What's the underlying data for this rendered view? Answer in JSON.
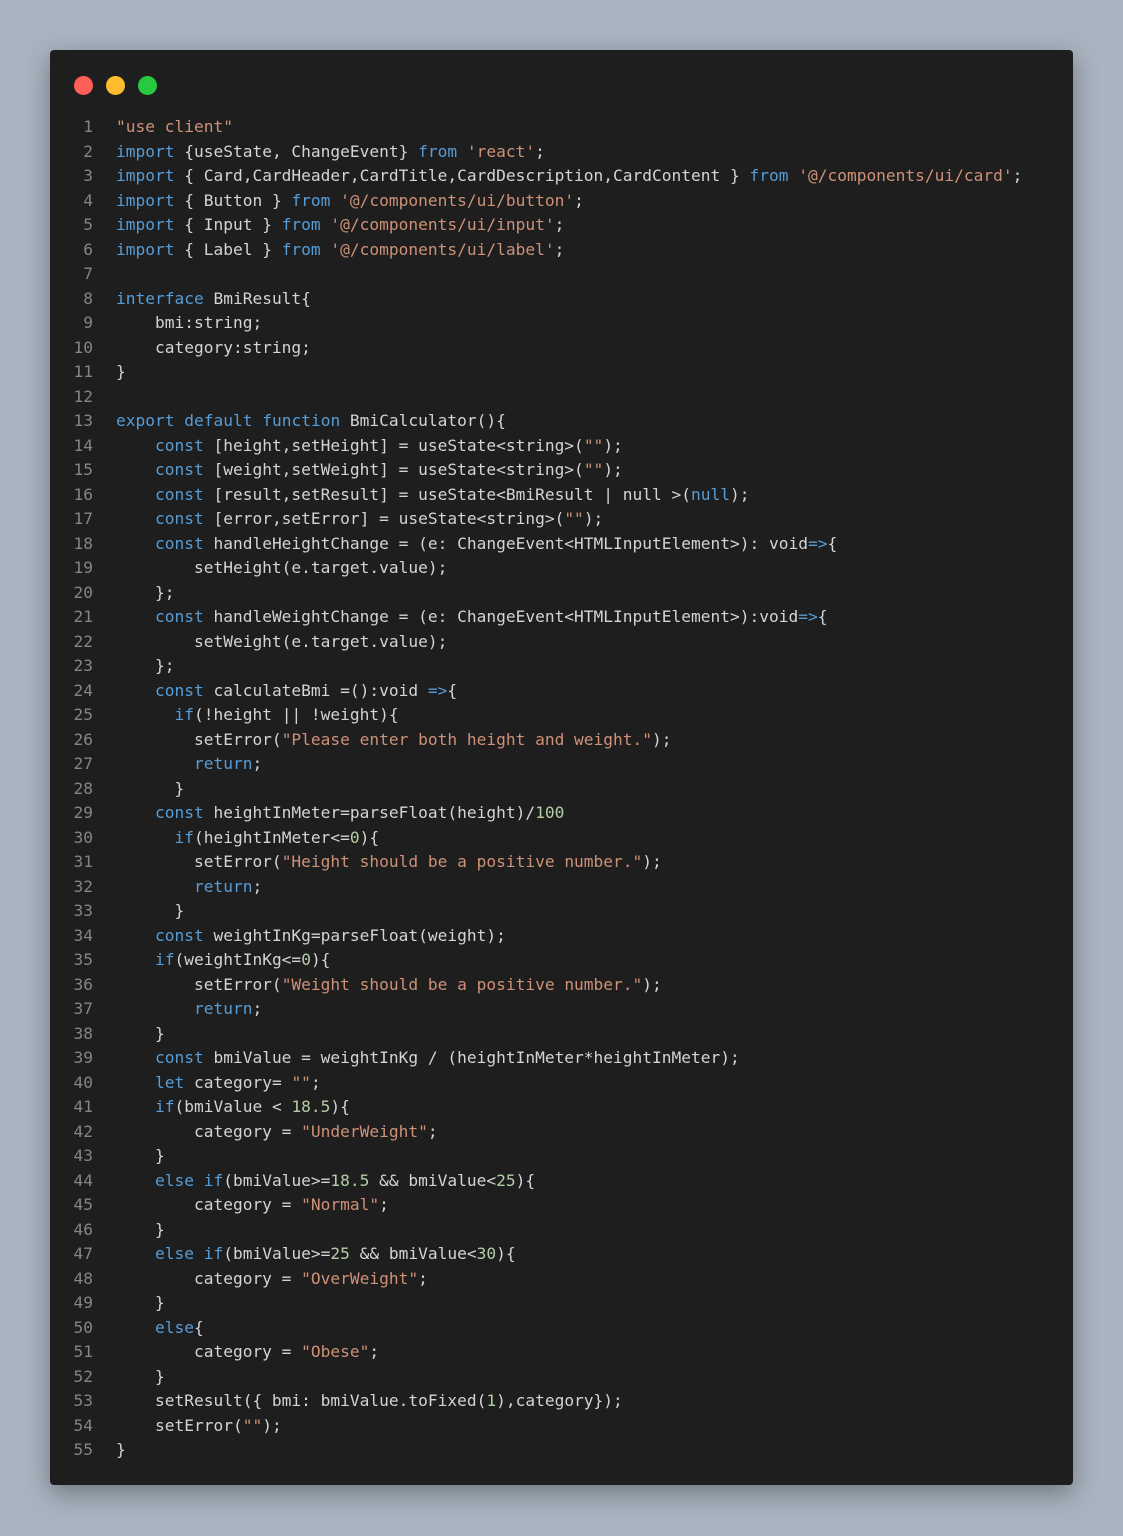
{
  "window": {
    "title_buttons": [
      {
        "name": "close-button",
        "color": "#ff5f56"
      },
      {
        "name": "minimize-button",
        "color": "#ffbd2e"
      },
      {
        "name": "maximize-button",
        "color": "#27c93f"
      }
    ],
    "background": "#1e1e1e"
  },
  "colors": {
    "keyword": "#569cd6",
    "string": "#ce9178",
    "number": "#b5cea8",
    "text": "#d4d4d4",
    "line_number": "#858585"
  },
  "code_lines": [
    {
      "n": "1",
      "tokens": [
        [
          "str",
          "\"use client\""
        ]
      ]
    },
    {
      "n": "2",
      "tokens": [
        [
          "kw",
          "import"
        ],
        [
          "t",
          " {useState, ChangeEvent} "
        ],
        [
          "kw",
          "from"
        ],
        [
          "t",
          " "
        ],
        [
          "str",
          "'react'"
        ],
        [
          "t",
          ";"
        ]
      ]
    },
    {
      "n": "3",
      "tokens": [
        [
          "kw",
          "import"
        ],
        [
          "t",
          " { Card,CardHeader,CardTitle,CardDescription,CardContent } "
        ],
        [
          "kw",
          "from"
        ],
        [
          "t",
          " "
        ],
        [
          "str",
          "'@/components/ui/card'"
        ],
        [
          "t",
          ";"
        ]
      ]
    },
    {
      "n": "4",
      "tokens": [
        [
          "kw",
          "import"
        ],
        [
          "t",
          " { Button } "
        ],
        [
          "kw",
          "from"
        ],
        [
          "t",
          " "
        ],
        [
          "str",
          "'@/components/ui/button'"
        ],
        [
          "t",
          ";"
        ]
      ]
    },
    {
      "n": "5",
      "tokens": [
        [
          "kw",
          "import"
        ],
        [
          "t",
          " { Input } "
        ],
        [
          "kw",
          "from"
        ],
        [
          "t",
          " "
        ],
        [
          "str",
          "'@/components/ui/input'"
        ],
        [
          "t",
          ";"
        ]
      ]
    },
    {
      "n": "6",
      "tokens": [
        [
          "kw",
          "import"
        ],
        [
          "t",
          " { Label } "
        ],
        [
          "kw",
          "from"
        ],
        [
          "t",
          " "
        ],
        [
          "str",
          "'@/components/ui/label'"
        ],
        [
          "t",
          ";"
        ]
      ]
    },
    {
      "n": "7",
      "tokens": []
    },
    {
      "n": "8",
      "tokens": [
        [
          "kw",
          "interface"
        ],
        [
          "t",
          " BmiResult{"
        ]
      ]
    },
    {
      "n": "9",
      "tokens": [
        [
          "t",
          "    bmi:string;"
        ]
      ]
    },
    {
      "n": "10",
      "tokens": [
        [
          "t",
          "    category:string;"
        ]
      ]
    },
    {
      "n": "11",
      "tokens": [
        [
          "t",
          "}"
        ]
      ]
    },
    {
      "n": "12",
      "tokens": []
    },
    {
      "n": "13",
      "tokens": [
        [
          "kw",
          "export"
        ],
        [
          "t",
          " "
        ],
        [
          "kw",
          "default"
        ],
        [
          "t",
          " "
        ],
        [
          "kw",
          "function"
        ],
        [
          "t",
          " BmiCalculator(){"
        ]
      ]
    },
    {
      "n": "14",
      "tokens": [
        [
          "t",
          "    "
        ],
        [
          "kw",
          "const"
        ],
        [
          "t",
          " [height,setHeight] = useState<string>("
        ],
        [
          "str",
          "\"\""
        ],
        [
          "t",
          ");"
        ]
      ]
    },
    {
      "n": "15",
      "tokens": [
        [
          "t",
          "    "
        ],
        [
          "kw",
          "const"
        ],
        [
          "t",
          " [weight,setWeight] = useState<string>("
        ],
        [
          "str",
          "\"\""
        ],
        [
          "t",
          ");"
        ]
      ]
    },
    {
      "n": "16",
      "tokens": [
        [
          "t",
          "    "
        ],
        [
          "kw",
          "const"
        ],
        [
          "t",
          " [result,setResult] = useState<BmiResult | null >("
        ],
        [
          "kw",
          "null"
        ],
        [
          "t",
          ");"
        ]
      ]
    },
    {
      "n": "17",
      "tokens": [
        [
          "t",
          "    "
        ],
        [
          "kw",
          "const"
        ],
        [
          "t",
          " [error,setError] = useState<string>("
        ],
        [
          "str",
          "\"\""
        ],
        [
          "t",
          ");"
        ]
      ]
    },
    {
      "n": "18",
      "tokens": [
        [
          "t",
          "    "
        ],
        [
          "kw",
          "const"
        ],
        [
          "t",
          " handleHeightChange = (e: ChangeEvent<HTMLInputElement>): void"
        ],
        [
          "kw",
          "=>"
        ],
        [
          "t",
          "{"
        ]
      ]
    },
    {
      "n": "19",
      "tokens": [
        [
          "t",
          "        setHeight(e.target.value);"
        ]
      ]
    },
    {
      "n": "20",
      "tokens": [
        [
          "t",
          "    };"
        ]
      ]
    },
    {
      "n": "21",
      "tokens": [
        [
          "t",
          "    "
        ],
        [
          "kw",
          "const"
        ],
        [
          "t",
          " handleWeightChange = (e: ChangeEvent<HTMLInputElement>):void"
        ],
        [
          "kw",
          "=>"
        ],
        [
          "t",
          "{"
        ]
      ]
    },
    {
      "n": "22",
      "tokens": [
        [
          "t",
          "        setWeight(e.target.value);"
        ]
      ]
    },
    {
      "n": "23",
      "tokens": [
        [
          "t",
          "    };"
        ]
      ]
    },
    {
      "n": "24",
      "tokens": [
        [
          "t",
          "    "
        ],
        [
          "kw",
          "const"
        ],
        [
          "t",
          " calculateBmi =():void "
        ],
        [
          "kw",
          "=>"
        ],
        [
          "t",
          "{"
        ]
      ]
    },
    {
      "n": "25",
      "tokens": [
        [
          "t",
          "      "
        ],
        [
          "fl",
          "if"
        ],
        [
          "t",
          "(!height || !weight){"
        ]
      ]
    },
    {
      "n": "26",
      "tokens": [
        [
          "t",
          "        setError("
        ],
        [
          "str",
          "\"Please enter both height and weight.\""
        ],
        [
          "t",
          ");"
        ]
      ]
    },
    {
      "n": "27",
      "tokens": [
        [
          "t",
          "        "
        ],
        [
          "fl",
          "return"
        ],
        [
          "t",
          ";"
        ]
      ]
    },
    {
      "n": "28",
      "tokens": [
        [
          "t",
          "      }"
        ]
      ]
    },
    {
      "n": "29",
      "tokens": [
        [
          "t",
          "    "
        ],
        [
          "kw",
          "const"
        ],
        [
          "t",
          " heightInMeter=parseFloat(height)/"
        ],
        [
          "num",
          "100"
        ]
      ]
    },
    {
      "n": "30",
      "tokens": [
        [
          "t",
          "      "
        ],
        [
          "fl",
          "if"
        ],
        [
          "t",
          "(heightInMeter<="
        ],
        [
          "num",
          "0"
        ],
        [
          "t",
          "){"
        ]
      ]
    },
    {
      "n": "31",
      "tokens": [
        [
          "t",
          "        setError("
        ],
        [
          "str",
          "\"Height should be a positive number.\""
        ],
        [
          "t",
          ");"
        ]
      ]
    },
    {
      "n": "32",
      "tokens": [
        [
          "t",
          "        "
        ],
        [
          "fl",
          "return"
        ],
        [
          "t",
          ";"
        ]
      ]
    },
    {
      "n": "33",
      "tokens": [
        [
          "t",
          "      }"
        ]
      ]
    },
    {
      "n": "34",
      "tokens": [
        [
          "t",
          "    "
        ],
        [
          "kw",
          "const"
        ],
        [
          "t",
          " weightInKg=parseFloat(weight);"
        ]
      ]
    },
    {
      "n": "35",
      "tokens": [
        [
          "t",
          "    "
        ],
        [
          "fl",
          "if"
        ],
        [
          "t",
          "(weightInKg<="
        ],
        [
          "num",
          "0"
        ],
        [
          "t",
          "){"
        ]
      ]
    },
    {
      "n": "36",
      "tokens": [
        [
          "t",
          "        setError("
        ],
        [
          "str",
          "\"Weight should be a positive number.\""
        ],
        [
          "t",
          ");"
        ]
      ]
    },
    {
      "n": "37",
      "tokens": [
        [
          "t",
          "        "
        ],
        [
          "fl",
          "return"
        ],
        [
          "t",
          ";"
        ]
      ]
    },
    {
      "n": "38",
      "tokens": [
        [
          "t",
          "    }"
        ]
      ]
    },
    {
      "n": "39",
      "tokens": [
        [
          "t",
          "    "
        ],
        [
          "kw",
          "const"
        ],
        [
          "t",
          " bmiValue = weightInKg / (heightInMeter*heightInMeter);"
        ]
      ]
    },
    {
      "n": "40",
      "tokens": [
        [
          "t",
          "    "
        ],
        [
          "kw",
          "let"
        ],
        [
          "t",
          " category= "
        ],
        [
          "str",
          "\"\""
        ],
        [
          "t",
          ";"
        ]
      ]
    },
    {
      "n": "41",
      "tokens": [
        [
          "t",
          "    "
        ],
        [
          "fl",
          "if"
        ],
        [
          "t",
          "(bmiValue < "
        ],
        [
          "num",
          "18.5"
        ],
        [
          "t",
          "){"
        ]
      ]
    },
    {
      "n": "42",
      "tokens": [
        [
          "t",
          "        category = "
        ],
        [
          "str",
          "\"UnderWeight\""
        ],
        [
          "t",
          ";"
        ]
      ]
    },
    {
      "n": "43",
      "tokens": [
        [
          "t",
          "    }"
        ]
      ]
    },
    {
      "n": "44",
      "tokens": [
        [
          "t",
          "    "
        ],
        [
          "fl",
          "else"
        ],
        [
          "t",
          " "
        ],
        [
          "fl",
          "if"
        ],
        [
          "t",
          "(bmiValue>="
        ],
        [
          "num",
          "18.5"
        ],
        [
          "t",
          " && bmiValue<"
        ],
        [
          "num",
          "25"
        ],
        [
          "t",
          "){"
        ]
      ]
    },
    {
      "n": "45",
      "tokens": [
        [
          "t",
          "        category = "
        ],
        [
          "str",
          "\"Normal\""
        ],
        [
          "t",
          ";"
        ]
      ]
    },
    {
      "n": "46",
      "tokens": [
        [
          "t",
          "    }"
        ]
      ]
    },
    {
      "n": "47",
      "tokens": [
        [
          "t",
          "    "
        ],
        [
          "fl",
          "else"
        ],
        [
          "t",
          " "
        ],
        [
          "fl",
          "if"
        ],
        [
          "t",
          "(bmiValue>="
        ],
        [
          "num",
          "25"
        ],
        [
          "t",
          " && bmiValue<"
        ],
        [
          "num",
          "30"
        ],
        [
          "t",
          "){"
        ]
      ]
    },
    {
      "n": "48",
      "tokens": [
        [
          "t",
          "        category = "
        ],
        [
          "str",
          "\"OverWeight\""
        ],
        [
          "t",
          ";"
        ]
      ]
    },
    {
      "n": "49",
      "tokens": [
        [
          "t",
          "    }"
        ]
      ]
    },
    {
      "n": "50",
      "tokens": [
        [
          "t",
          "    "
        ],
        [
          "fl",
          "else"
        ],
        [
          "t",
          "{"
        ]
      ]
    },
    {
      "n": "51",
      "tokens": [
        [
          "t",
          "        category = "
        ],
        [
          "str",
          "\"Obese\""
        ],
        [
          "t",
          ";"
        ]
      ]
    },
    {
      "n": "52",
      "tokens": [
        [
          "t",
          "    }"
        ]
      ]
    },
    {
      "n": "53",
      "tokens": [
        [
          "t",
          "    setResult({ bmi: bmiValue.toFixed("
        ],
        [
          "num",
          "1"
        ],
        [
          "t",
          "),category});"
        ]
      ]
    },
    {
      "n": "54",
      "tokens": [
        [
          "t",
          "    setError("
        ],
        [
          "str",
          "\"\""
        ],
        [
          "t",
          ");"
        ]
      ]
    },
    {
      "n": "55",
      "tokens": [
        [
          "t",
          "}"
        ]
      ]
    }
  ]
}
